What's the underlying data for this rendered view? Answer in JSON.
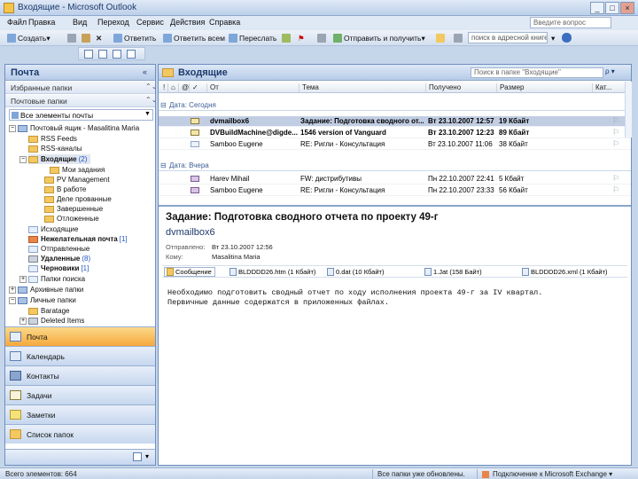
{
  "window": {
    "title": "Входящие - Microsoft Outlook",
    "min": "_",
    "max": "□",
    "close": "×"
  },
  "menu": [
    "Файл",
    "Правка",
    "Вид",
    "Переход",
    "Сервис",
    "Действия",
    "Справка"
  ],
  "help_search_placeholder": "Введите вопрос",
  "toolbar": {
    "create": "Создать",
    "reply": "Ответить",
    "reply_all": "Ответить всем",
    "forward": "Переслать",
    "send_receive": "Отправить и получить",
    "search_address": "поиск в адресной книге"
  },
  "nav": {
    "title": "Почта",
    "title_ctl": "«",
    "favorites": "Избранные папки",
    "mail_folders": "Почтовые папки",
    "all_items": "Все элементы почты",
    "tree": [
      {
        "label": "Почтовый ящик - Masalitina Maria",
        "count": ""
      },
      {
        "label": "RSS Feeds",
        "count": ""
      },
      {
        "label": "RSS-каналы",
        "count": ""
      },
      {
        "label": "Входящие",
        "count": "(2)"
      },
      {
        "label": "Мои задания",
        "count": ""
      },
      {
        "label": "PV Management",
        "count": ""
      },
      {
        "label": "В работе",
        "count": ""
      },
      {
        "label": "Деле прованные",
        "count": ""
      },
      {
        "label": "Завершенные",
        "count": ""
      },
      {
        "label": "Отложенные",
        "count": ""
      },
      {
        "label": "Исходящие",
        "count": ""
      },
      {
        "label": "Нежелательная почта",
        "count": "[1]"
      },
      {
        "label": "Отправленные",
        "count": ""
      },
      {
        "label": "Удаленные",
        "count": "(8)"
      },
      {
        "label": "Черновики",
        "count": "[1]"
      },
      {
        "label": "Папки поиска",
        "count": ""
      },
      {
        "label": "Архивные папки",
        "count": ""
      },
      {
        "label": "Личные папки",
        "count": ""
      },
      {
        "label": "Baratage",
        "count": ""
      },
      {
        "label": "Deleted Items",
        "count": ""
      }
    ],
    "buttons": [
      "Почта",
      "Календарь",
      "Контакты",
      "Задачи",
      "Заметки",
      "Список папок"
    ]
  },
  "main": {
    "title": "Входящие",
    "search_placeholder": "Поиск в папке \"Входящие\"",
    "search_btn": "ρ ▾",
    "columns": [
      "От",
      "Тема",
      "Получено",
      "Размер",
      "Кат..."
    ],
    "groups": [
      {
        "label": "Дата: Сегодня",
        "rows": [
          {
            "from": "dvmailbox6",
            "subject": "Задание: Подготовка сводного от...",
            "received": "Вт 23.10.2007 12:57",
            "size": "19 Кбайт",
            "bold": true
          },
          {
            "from": "DVBuildMachine@digde...",
            "subject": "1546 version of Vanguard",
            "received": "Вт 23.10.2007 12:23",
            "size": "89 Кбайт",
            "bold": true
          },
          {
            "from": "Samboo Eugene",
            "subject": "RE: Ригли - Консультация",
            "received": "Вт 23.10.2007 11:06",
            "size": "38 Кбайт",
            "bold": false
          }
        ]
      },
      {
        "label": "Дата: Вчера",
        "rows": [
          {
            "from": "Harev Mihail",
            "subject": "FW: дистрибутивы",
            "received": "Пн 22.10.2007 22:41",
            "size": "5 Кбайт",
            "bold": false
          },
          {
            "from": "Samboo Eugene",
            "subject": "RE: Ригли - Консультация",
            "received": "Пн 22.10.2007 23:33",
            "size": "56 Кбайт",
            "bold": false
          }
        ]
      }
    ]
  },
  "reading": {
    "subject": "Задание: Подготовка сводного отчета по проекту 49-г",
    "from": "dvmailbox6",
    "sent_label": "Отправлено:",
    "sent_value": "Вт 23.10.2007 12:56",
    "to_label": "Кому:",
    "to_value": "Masalitina Maria",
    "attachments": [
      "Сообщение",
      "BLDDDD26.htm (1 Кбайт)",
      "0.dat (10 Кбайт)",
      "1.Jat (158 Байт)",
      "BLDDDD26.xml (1 Кбайт)"
    ],
    "body": "Необходимо подготовить сводный отчет по ходу исполнения проекта 49-г за IV квартал.\nПервичные данные содержатся в приложенных файлах."
  },
  "status": {
    "count": "Всего элементов: 664",
    "updated": "Все папки уже обновлены.",
    "connection": "Подключение к Microsoft Exchange ▾"
  }
}
